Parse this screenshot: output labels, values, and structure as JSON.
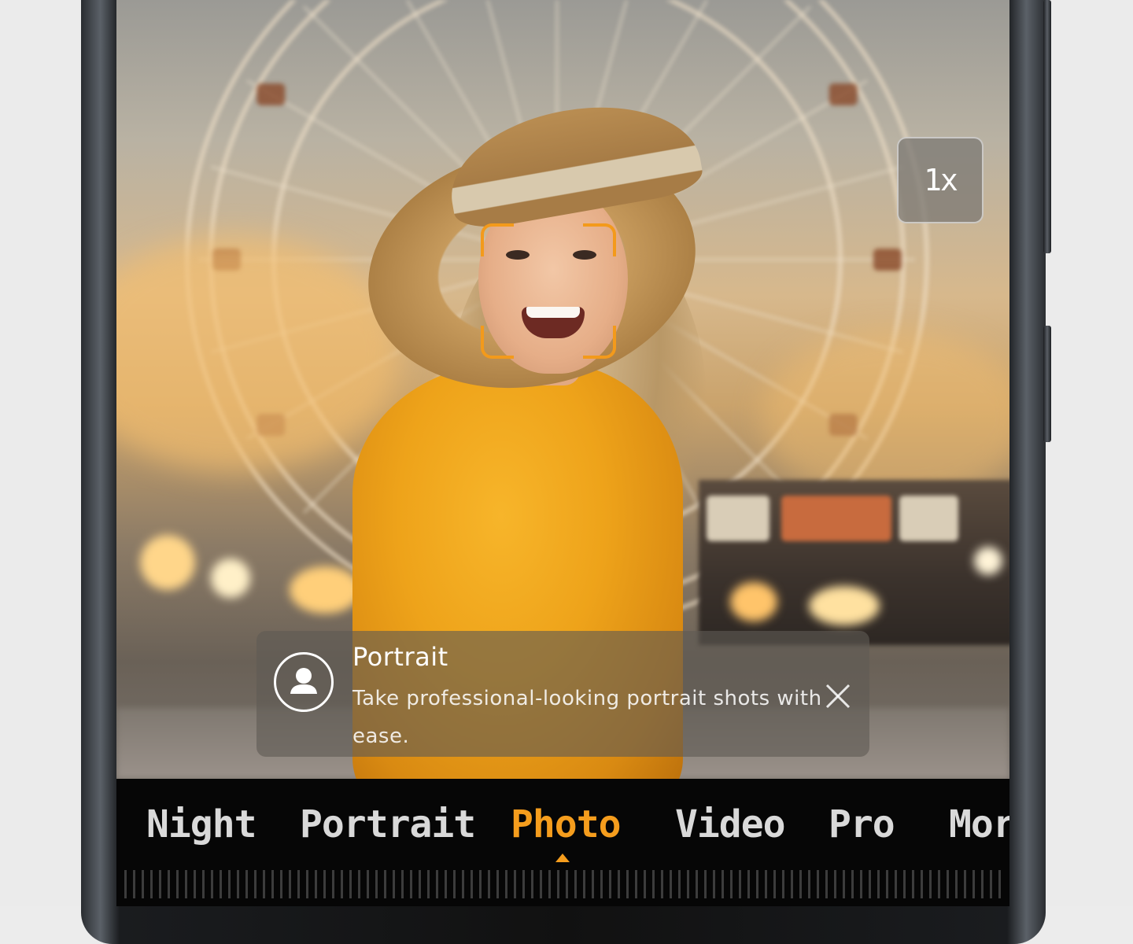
{
  "camera": {
    "zoom_level": "1x",
    "face_detected": true
  },
  "tip": {
    "icon": "portrait-person-icon",
    "title": "Portrait",
    "body": "Take professional-looking portrait shots with ease.",
    "close_icon": "close-icon"
  },
  "modes": [
    {
      "label": "Night",
      "active": false
    },
    {
      "label": "Portrait",
      "active": false
    },
    {
      "label": "Photo",
      "active": true
    },
    {
      "label": "Video",
      "active": false
    },
    {
      "label": "Pro",
      "active": false
    },
    {
      "label": "More",
      "active": false
    }
  ],
  "colors": {
    "accent": "#f59d1d",
    "mode_inactive": "#d9d9d9",
    "focus_frame": "#f39a1b"
  }
}
